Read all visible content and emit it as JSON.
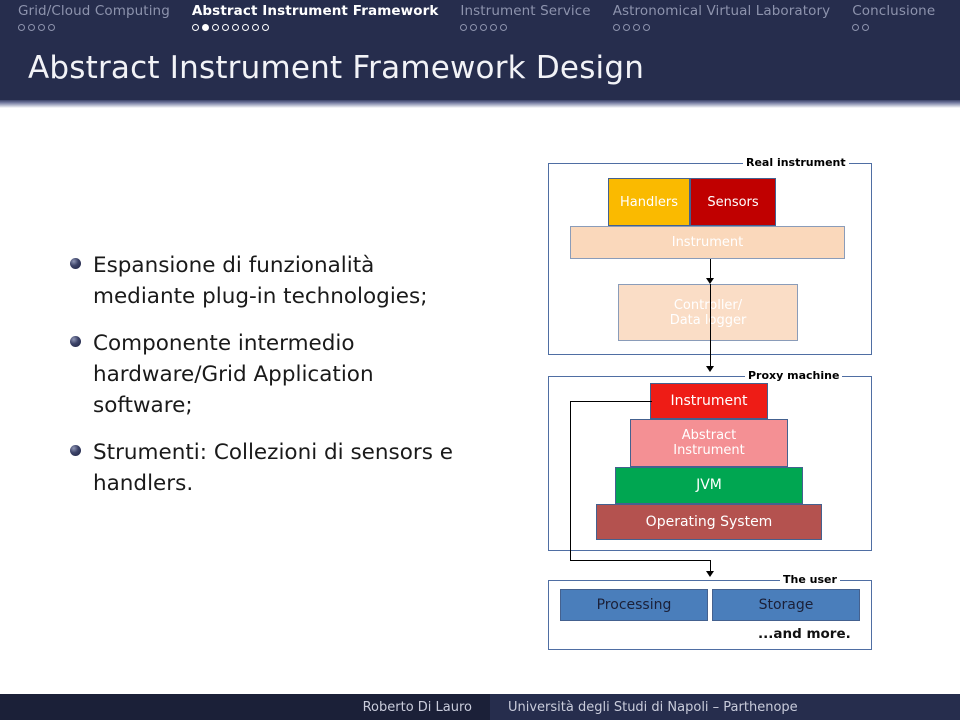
{
  "nav": {
    "sections": [
      {
        "label": "Grid/Cloud Computing",
        "dots": 4,
        "active_index": -1,
        "active": false
      },
      {
        "label": "Abstract Instrument Framework",
        "dots": 8,
        "active_index": 1,
        "active": true
      },
      {
        "label": "Instrument Service",
        "dots": 5,
        "active_index": -1,
        "active": false
      },
      {
        "label": "Astronomical Virtual Laboratory",
        "dots": 4,
        "active_index": -1,
        "active": false
      },
      {
        "label": "Conclusione",
        "dots": 2,
        "active_index": -1,
        "active": false
      }
    ]
  },
  "slide": {
    "title": "Abstract Instrument Framework Design",
    "bullets": [
      "Espansione di funzionalità mediante plug-in technologies;",
      "Componente intermedio hardware/Grid Application software;",
      "Strumenti: Collezioni di sensors e handlers."
    ]
  },
  "diagram": {
    "groups": [
      {
        "name": "real-instrument",
        "label": "Real instrument",
        "blocks": [
          {
            "name": "handlers",
            "label": "Handlers",
            "fill": "#FABA00",
            "text_color": "#ffffff",
            "faded": false
          },
          {
            "name": "sensors",
            "label": "Sensors",
            "fill": "#C00000",
            "text_color": "#ffffff",
            "faded": false
          },
          {
            "name": "instrument",
            "label": "Instrument",
            "fill": "#F8C193",
            "text_color": "#ffffff",
            "faded": true
          },
          {
            "name": "controller-data-logger",
            "label": "Controller/\nData logger",
            "fill": "#F8C9A4",
            "text_color": "#ffffff",
            "faded": true
          }
        ]
      },
      {
        "name": "proxy-machine",
        "label": "Proxy machine",
        "blocks": [
          {
            "name": "proxy-instrument",
            "label": "Instrument",
            "fill": "#EE1C16",
            "text_color": "#ffffff",
            "faded": false
          },
          {
            "name": "abstract-instrument",
            "label": "Abstract\nInstrument",
            "fill": "#F49094",
            "text_color": "#ffffff",
            "faded": false
          },
          {
            "name": "jvm",
            "label": "JVM",
            "fill": "#00A651",
            "text_color": "#ffffff",
            "faded": false
          },
          {
            "name": "operating-system",
            "label": "Operating System",
            "fill": "#B4524F",
            "text_color": "#ffffff",
            "faded": false
          }
        ]
      },
      {
        "name": "the-user",
        "label": "The user",
        "blocks": [
          {
            "name": "processing",
            "label": "Processing",
            "fill": "#4A7EBB",
            "text_color": "#1b2038",
            "faded": false
          },
          {
            "name": "storage",
            "label": "Storage",
            "fill": "#4A7EBB",
            "text_color": "#1b2038",
            "faded": false
          }
        ],
        "note": "...and more."
      }
    ]
  },
  "footer": {
    "author": "Roberto Di Lauro",
    "affiliation": "Università degli Studi di Napoli – Parthenope"
  }
}
